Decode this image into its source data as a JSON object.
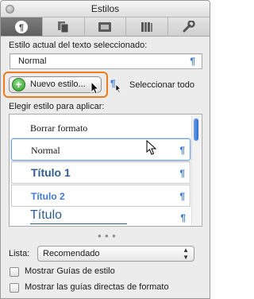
{
  "window": {
    "title": "Estilos"
  },
  "tabs": [
    {
      "icon": "paragraph-styles-icon"
    },
    {
      "icon": "copy-pages-icon"
    },
    {
      "icon": "image-panel-icon"
    },
    {
      "icon": "library-books-icon"
    },
    {
      "icon": "wrench-icon"
    }
  ],
  "current_style": {
    "label": "Estilo actual del texto seleccionado:",
    "value": "Normal",
    "marker": "¶"
  },
  "actions": {
    "new_style_label": "Nuevo estilo...",
    "select_all_label": "Seleccionar todo",
    "select_all_marker": "¶"
  },
  "styles_list": {
    "label": "Elegir estilo para aplicar:",
    "items": [
      {
        "text": "Borrar formato",
        "marker": ""
      },
      {
        "text": "Normal",
        "marker": "¶"
      },
      {
        "text": "Título 1",
        "marker": "¶"
      },
      {
        "text": "Título 2",
        "marker": "¶"
      },
      {
        "text": "Título",
        "marker": "¶"
      }
    ]
  },
  "list_filter": {
    "label": "Lista:",
    "selected": "Recomendado"
  },
  "options": [
    {
      "label": "Mostrar Guías de estilo",
      "checked": false
    },
    {
      "label": "Mostrar las guías directas de formato",
      "checked": false
    }
  ],
  "colors": {
    "accent": "#3e7bd6",
    "heading_blue": "#2f5d8e",
    "highlight": "#f07b1a",
    "add_green": "#2e9a27"
  }
}
